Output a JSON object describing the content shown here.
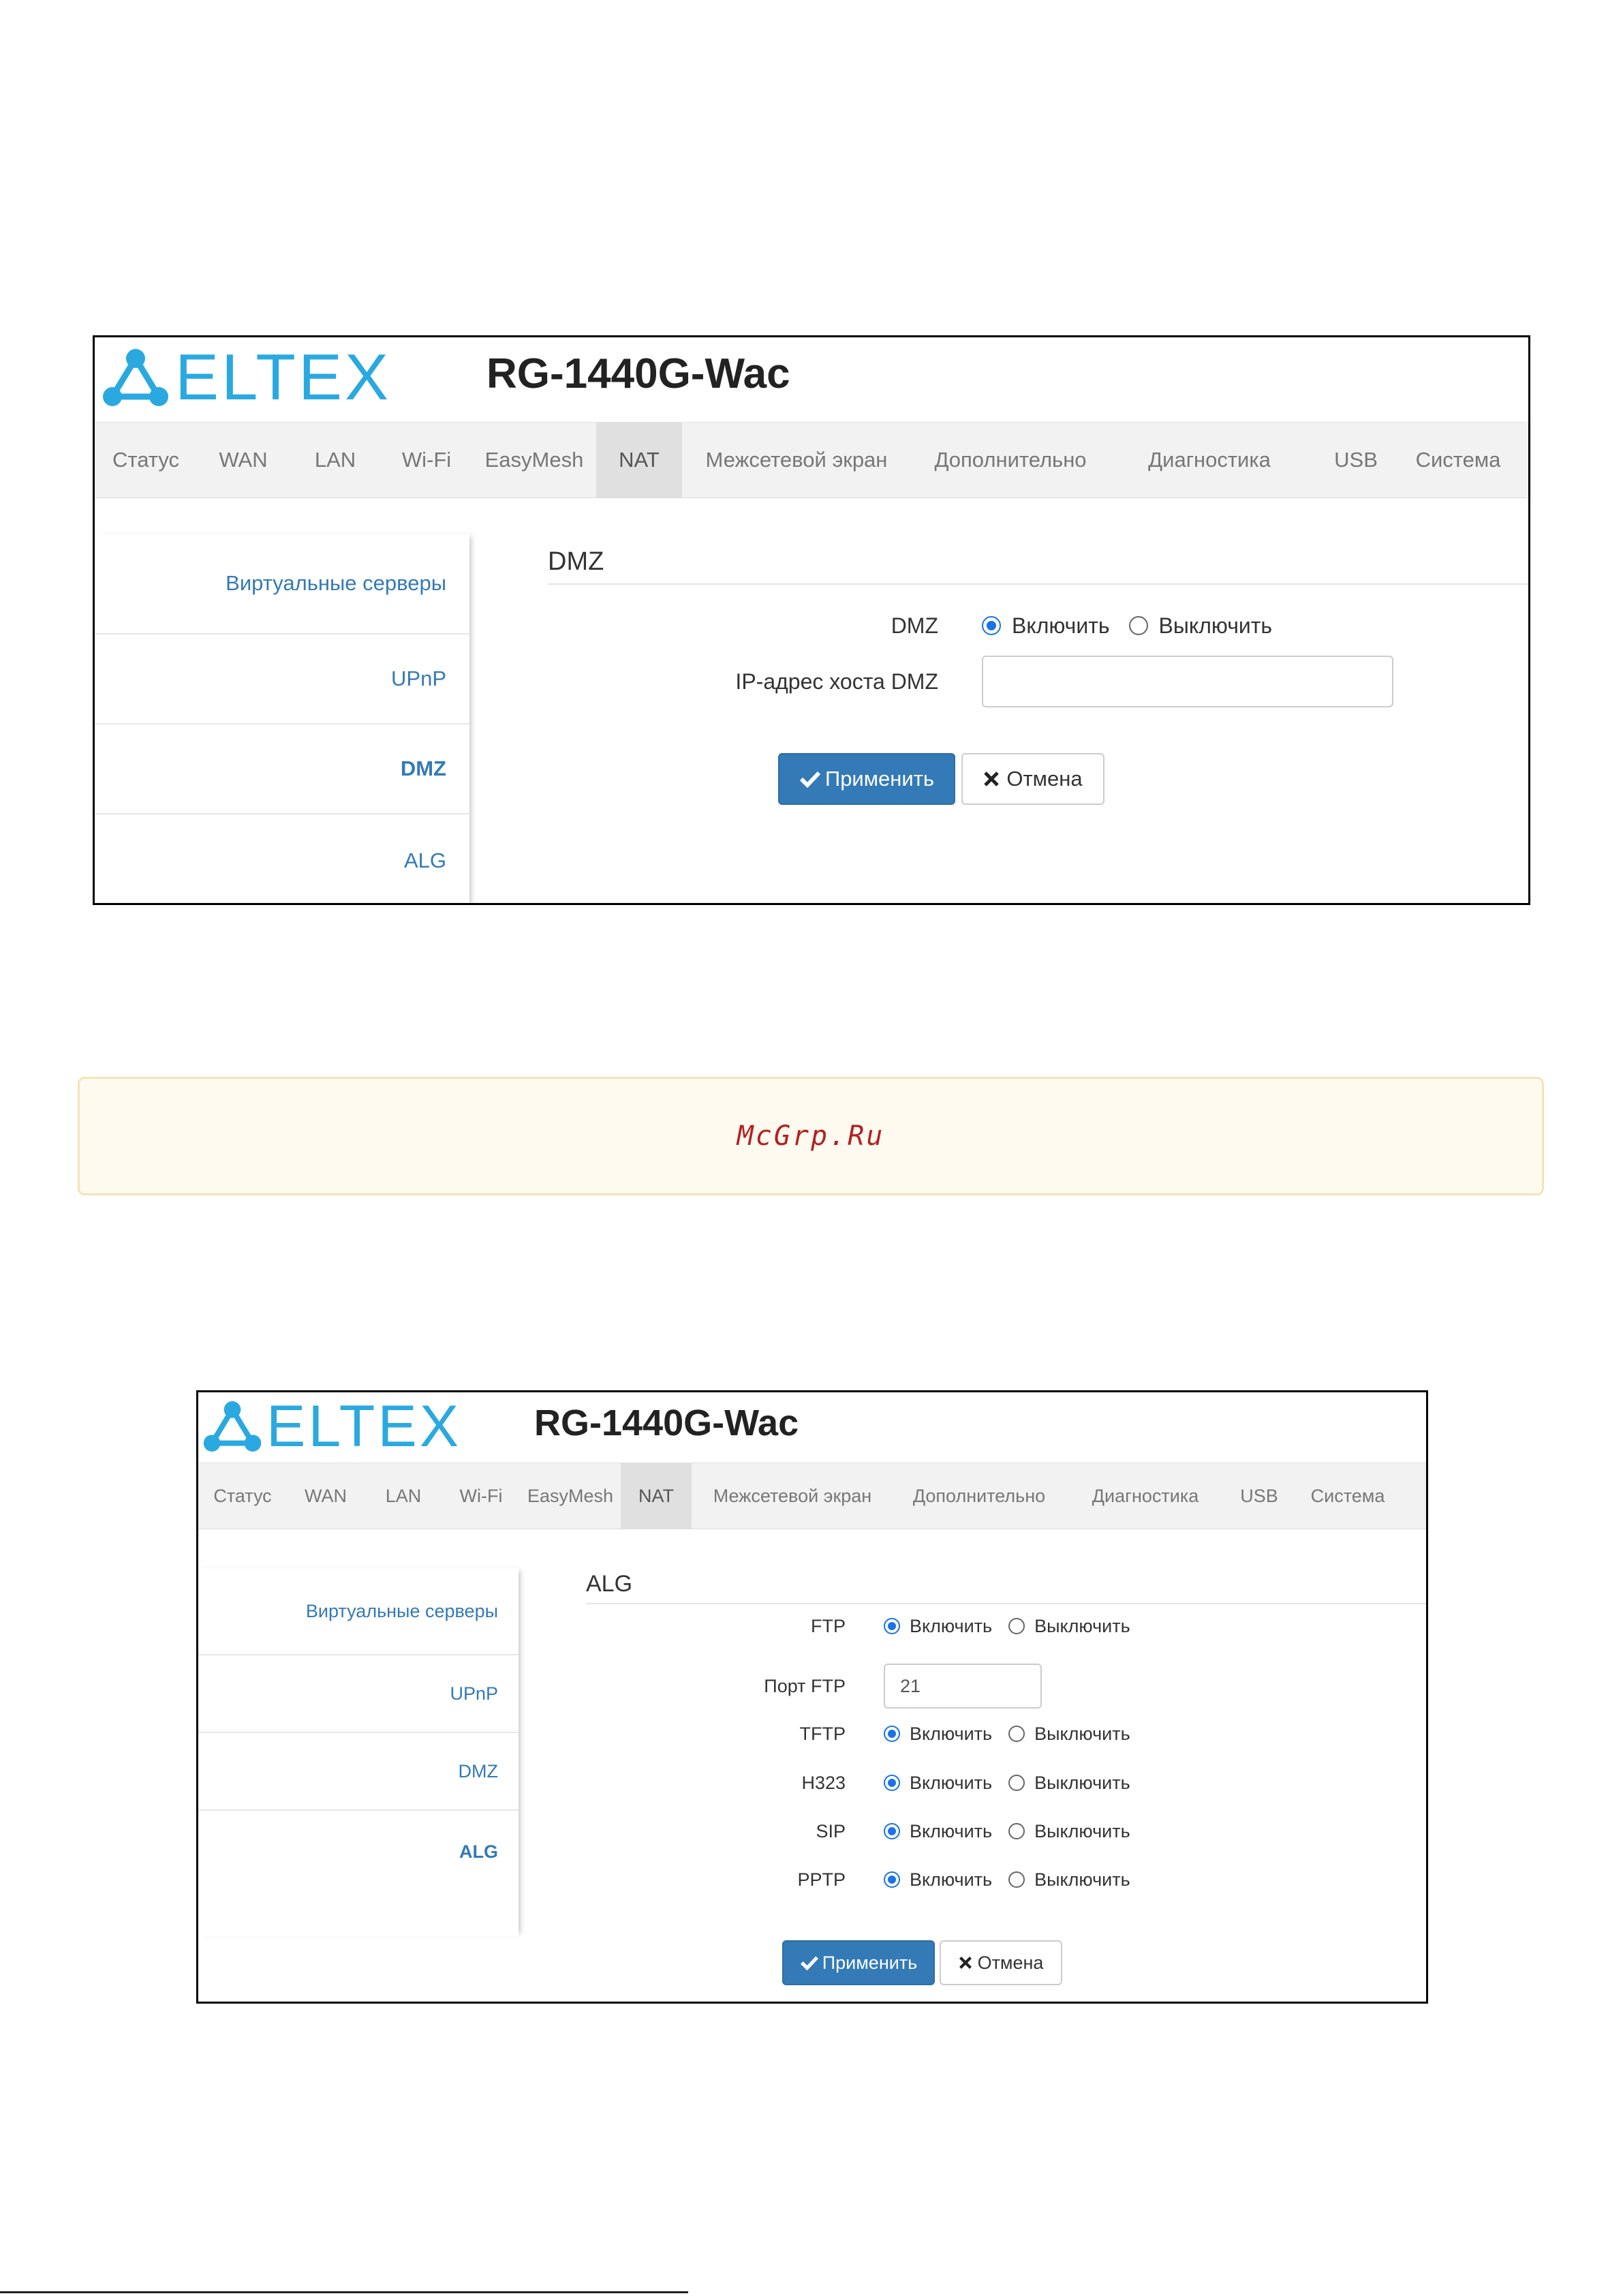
{
  "screen1": {
    "brand": "ELTEX",
    "model": "RG-1440G-Wac",
    "nav": [
      "Статус",
      "WAN",
      "LAN",
      "Wi-Fi",
      "EasyMesh",
      "NAT",
      "Межсетевой экран",
      "Дополнительно",
      "Диагностика",
      "USB",
      "Система"
    ],
    "nav_active": "NAT",
    "sidebar": [
      "Виртуальные серверы",
      "UPnP",
      "DMZ",
      "ALG"
    ],
    "sidebar_active": "DMZ",
    "section_title": "DMZ",
    "dmz_label": "DMZ",
    "enable_label": "Включить",
    "disable_label": "Выключить",
    "dmz_enabled": true,
    "host_label": "IP-адрес хоста DMZ",
    "host_value": "",
    "apply_label": "Применить",
    "cancel_label": "Отмена"
  },
  "notice": {
    "text": "McGrp.Ru"
  },
  "screen2": {
    "brand": "ELTEX",
    "model": "RG-1440G-Wac",
    "nav": [
      "Статус",
      "WAN",
      "LAN",
      "Wi-Fi",
      "EasyMesh",
      "NAT",
      "Межсетевой экран",
      "Дополнительно",
      "Диагностика",
      "USB",
      "Система"
    ],
    "nav_active": "NAT",
    "sidebar": [
      "Виртуальные серверы",
      "UPnP",
      "DMZ",
      "ALG"
    ],
    "sidebar_active": "ALG",
    "section_title": "ALG",
    "enable_label": "Включить",
    "disable_label": "Выключить",
    "ftp_label": "FTP",
    "ftp_port_label": "Порт FTP",
    "ftp_port_value": "21",
    "tftp_label": "TFTP",
    "h323_label": "H323",
    "sip_label": "SIP",
    "pptp_label": "PPTP",
    "apply_label": "Применить",
    "cancel_label": "Отмена"
  },
  "colors": {
    "accent": "#337ab7",
    "logo": "#2aa9e0",
    "radio": "#1a73e8"
  }
}
